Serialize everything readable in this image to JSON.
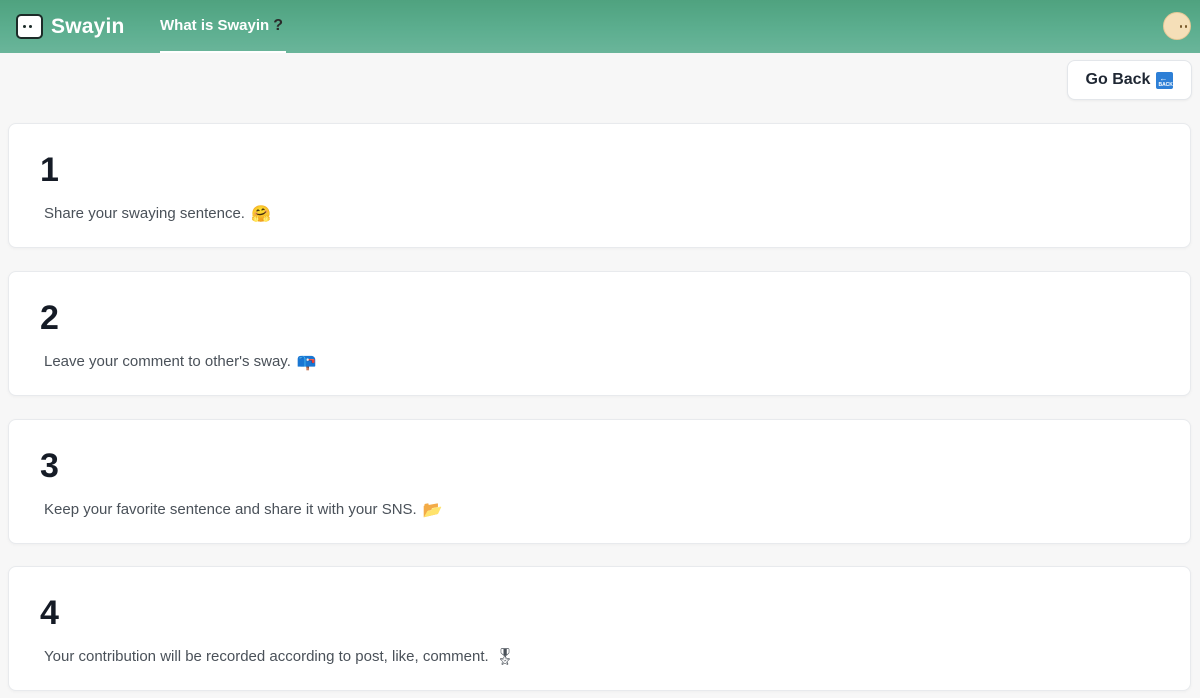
{
  "header": {
    "brand": "Swayin",
    "nav_tab": "What is Swayin",
    "nav_tab_icon": "?"
  },
  "go_back": {
    "label": "Go Back",
    "icon_text": "BACK",
    "icon_arrow": "←"
  },
  "steps": [
    {
      "number": "1",
      "text": "Share your swaying sentence.",
      "emoji": "🤗"
    },
    {
      "number": "2",
      "text": "Leave your comment to other's sway.",
      "emoji": "📪"
    },
    {
      "number": "3",
      "text": "Keep your favorite sentence and share it with your SNS.",
      "emoji": "📂"
    },
    {
      "number": "4",
      "text": "Your contribution will be recorded according to post, like, comment.",
      "emoji": "🎖"
    }
  ],
  "colors": {
    "header_green": "#5cae8f",
    "back_icon_blue": "#2d7fd6"
  }
}
